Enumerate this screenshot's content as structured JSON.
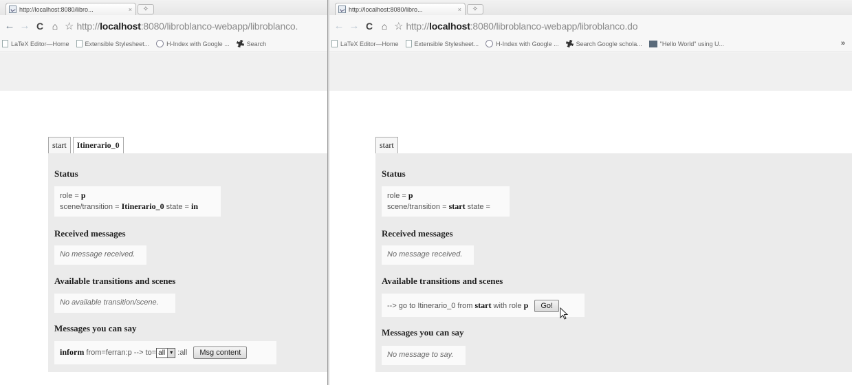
{
  "left": {
    "tab_title": "http://localhost:8080/libro...",
    "tab_close": "×",
    "url_prefix": "http://",
    "url_host": "localhost",
    "url_rest": ":8080/libroblanco-webapp/libroblanco.",
    "bookmarks": [
      "LaTeX Editor—Home",
      "Extensible Stylesheet...",
      "H-Index with Google ...",
      "Search"
    ],
    "tabs": [
      "start",
      "Itinerario_0"
    ],
    "status_title": "Status",
    "role_label": "role = ",
    "role_value": "p",
    "scene_label": "scene/transition = ",
    "scene_value": "Itinerario_0",
    "state_label": " state = ",
    "state_value": "in",
    "received_title": "Received messages",
    "received_text": "No message received.",
    "available_title": "Available transitions and scenes",
    "available_text": "No available transition/scene.",
    "say_title": "Messages you can say",
    "say_performative": "inform",
    "say_from": " from=ferran:p --> to=",
    "say_select": "all",
    "say_after": " :all",
    "say_button": "Msg content"
  },
  "right": {
    "tab_title": "http://localhost:8080/libro...",
    "tab_close": "×",
    "url_prefix": "http://",
    "url_host": "localhost",
    "url_rest": ":8080/libroblanco-webapp/libroblanco.do",
    "bookmarks": [
      "LaTeX Editor—Home",
      "Extensible Stylesheet...",
      "H-Index with Google ...",
      "Search Google schola...",
      "\"Hello World\" using U..."
    ],
    "bookmarks_more": "»",
    "tabs": [
      "start"
    ],
    "status_title": "Status",
    "role_label": "role = ",
    "role_value": "p",
    "scene_label": "scene/transition = ",
    "scene_value": "start",
    "state_label": " state =",
    "received_title": "Received messages",
    "received_text": "No message received.",
    "available_title": "Available transitions and scenes",
    "go_prefix": "--> go to Itinerario_0 from ",
    "go_from": "start",
    "go_mid": " with role ",
    "go_role": "p",
    "go_button": "Go!",
    "say_title": "Messages you can say",
    "say_text": "No message to say."
  },
  "icons": {
    "back": "←",
    "forward": "→",
    "reload": "C",
    "home": "⌂",
    "star": "☆",
    "newtab": "✧",
    "arrow_down": "▼"
  }
}
